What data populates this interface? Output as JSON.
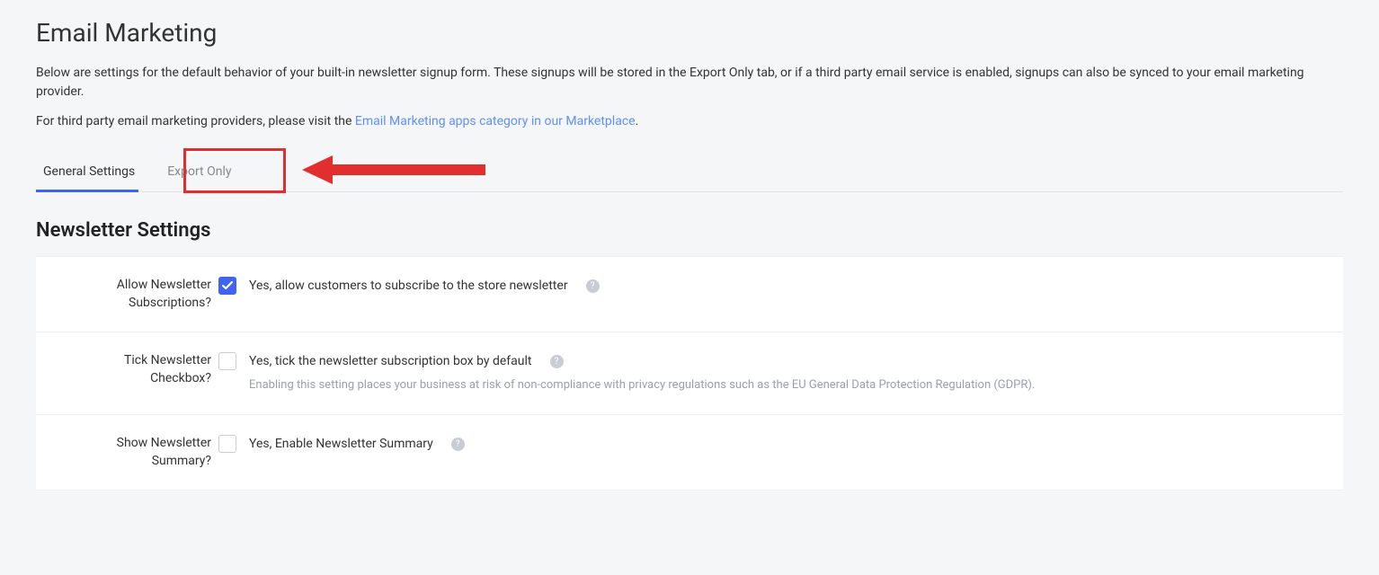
{
  "header": {
    "title": "Email Marketing",
    "description": "Below are settings for the default behavior of your built-in newsletter signup form. These signups will be stored in the Export Only tab, or if a third party email service is enabled, signups can also be synced to your email marketing provider.",
    "provider_line_prefix": "For third party email marketing providers, please visit the ",
    "provider_link": "Email Marketing apps category in our Marketplace",
    "provider_line_suffix": "."
  },
  "tabs": {
    "general": "General Settings",
    "export": "Export Only"
  },
  "section": {
    "title": "Newsletter Settings"
  },
  "settings": {
    "allow": {
      "label": "Allow Newsletter Subscriptions?",
      "text": "Yes, allow customers to subscribe to the store newsletter",
      "checked": true
    },
    "tick": {
      "label": "Tick Newsletter Checkbox?",
      "text": "Yes, tick the newsletter subscription box by default",
      "checked": false,
      "warn": "Enabling this setting places your business at risk of non-compliance with privacy regulations such as the EU General Data Protection Regulation (GDPR)."
    },
    "summary": {
      "label": "Show Newsletter Summary?",
      "text": "Yes, Enable Newsletter Summary",
      "checked": false
    }
  },
  "icons": {
    "help": "?"
  }
}
